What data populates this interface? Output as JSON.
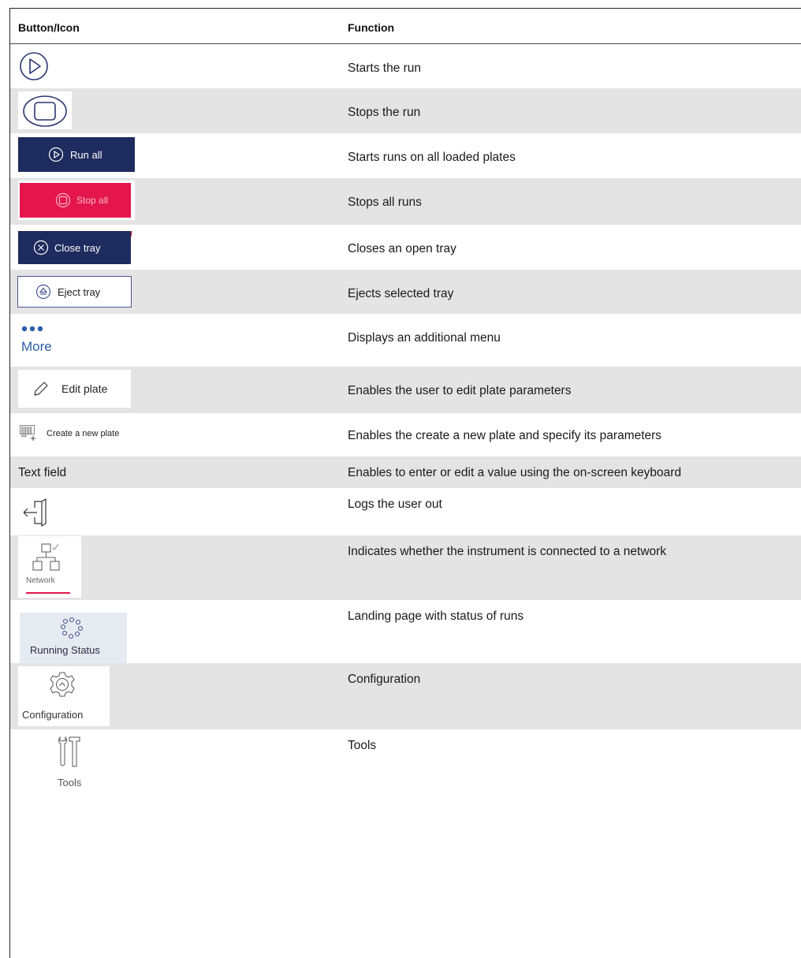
{
  "header": {
    "col1": "Button/Icon",
    "col2": "Function"
  },
  "rows": [
    {
      "icon": "play-circle-icon",
      "function": "Starts the run"
    },
    {
      "icon": "stop-circle-icon",
      "function": "Stops the run"
    },
    {
      "icon": "run-all-button",
      "label": "Run all",
      "function": "Starts runs on all loaded plates"
    },
    {
      "icon": "stop-all-button",
      "label": "Stop all",
      "function": "Stops all runs"
    },
    {
      "icon": "close-tray-button",
      "label": "Close tray",
      "function": "Closes an open tray"
    },
    {
      "icon": "eject-tray-button",
      "label": "Eject tray",
      "function": "Ejects selected tray"
    },
    {
      "icon": "more-icon",
      "label": "More",
      "function": "Displays an additional menu"
    },
    {
      "icon": "edit-plate-button",
      "label": "Edit plate",
      "function": "Enables the user to edit plate parameters"
    },
    {
      "icon": "create-plate-button",
      "label": "Create a new plate",
      "function": "Enables the create a new plate and specify its parameters"
    },
    {
      "icon": "",
      "label": "Text field",
      "function": "Enables to enter or edit a value using the on-screen keyboard"
    },
    {
      "icon": "logout-icon",
      "function": "Logs the user out"
    },
    {
      "icon": "network-icon",
      "label": "Network",
      "function": "Indicates whether the instrument is connected to a network"
    },
    {
      "icon": "running-status-icon",
      "label": "Running Status",
      "function": "Landing page with status of runs"
    },
    {
      "icon": "configuration-icon",
      "label": "Configuration",
      "function": "Configuration"
    },
    {
      "icon": "tools-icon",
      "label": "Tools",
      "function": "Tools"
    }
  ],
  "colors": {
    "navy": "#1e2b5e",
    "red": "#e4164c",
    "shade": "#e4e4e4",
    "link_blue": "#2b5fa6"
  }
}
